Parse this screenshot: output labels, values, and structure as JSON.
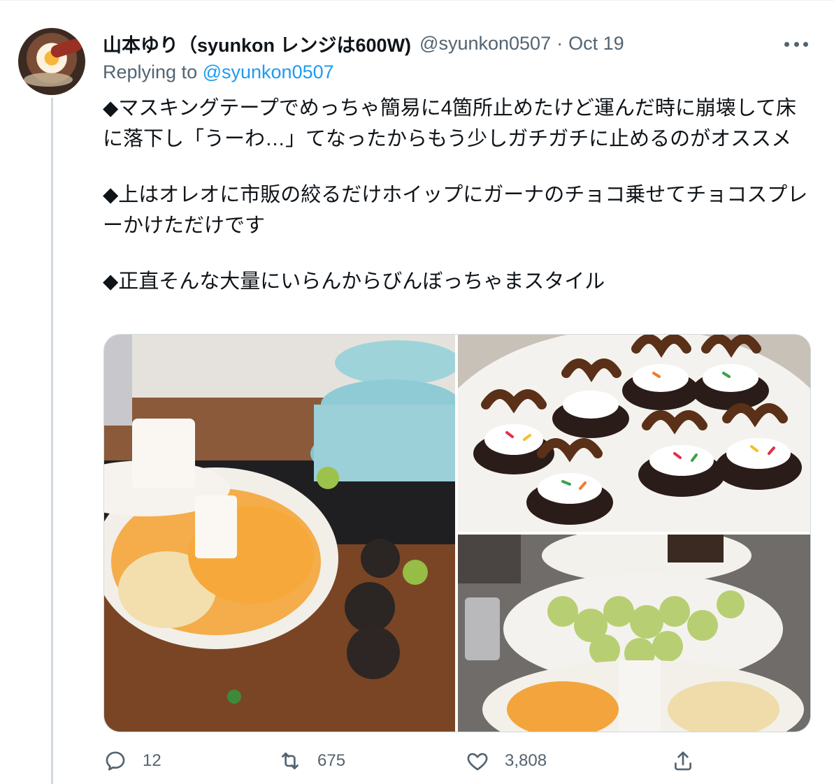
{
  "tweet": {
    "author": {
      "display_name": "山本ゆり（syunkon レンジは600W)",
      "handle": "@syunkon0507",
      "date": "Oct 19"
    },
    "separator": "·",
    "replying_prefix": "Replying to ",
    "replying_to": "@syunkon0507",
    "paragraphs": [
      "◆マスキングテープでめっちゃ簡易に4箇所止めたけど運んだ時に崩壊して床に落下し「うーわ…」てなったからもう少しガチガチに止めるのがオススメ",
      "◆上はオレオに市販の絞るだけホイップにガーナのチョコ乗せてチョコスプレーかけただけです",
      "◆正直そんな大量にいらんからびんぼっちゃまスタイル"
    ]
  },
  "actions": {
    "replies": "12",
    "retweets": "675",
    "likes": "3,808"
  },
  "icons": {
    "more": "more-horizontal-icon",
    "reply": "reply-icon",
    "retweet": "retweet-icon",
    "like": "heart-icon",
    "share": "share-icon"
  },
  "colors": {
    "link": "#1d9bf0",
    "secondary_text": "#536471",
    "primary_text": "#0f1419",
    "thread_line": "#cfd9de"
  }
}
